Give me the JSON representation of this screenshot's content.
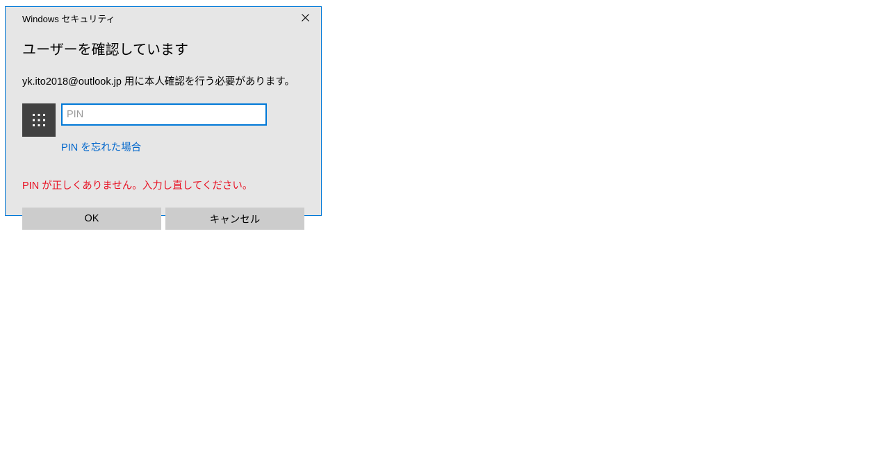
{
  "dialog": {
    "title": "Windows セキュリティ",
    "heading": "ユーザーを確認しています",
    "instruction": "yk.ito2018@outlook.jp 用に本人確認を行う必要があります。",
    "pin_placeholder": "PIN",
    "pin_value": "",
    "forgot_pin": "PIN を忘れた場合",
    "error": "PIN が正しくありません。入力し直してください。",
    "ok_label": "OK",
    "cancel_label": "キャンセル"
  }
}
